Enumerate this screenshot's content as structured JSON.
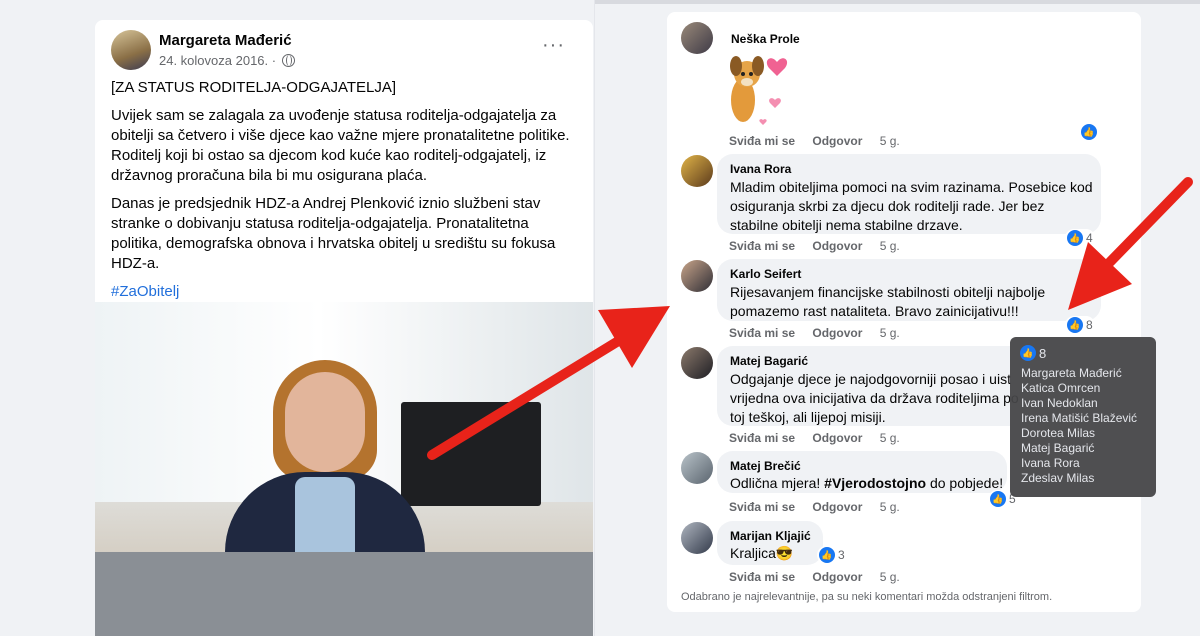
{
  "post": {
    "author": "Margareta Mađerić",
    "date": "24. kolovoza 2016.",
    "meta_sep": "·",
    "more": "···",
    "title": "[ZA STATUS RODITELJA-ODGAJATELJA]",
    "paragraph1": "Uvijek sam se zalagala za uvođenje statusa roditelja-odgajatelja za obitelji sa četvero i više djece kao važne mjere pronatalitetne politike. Roditelj koji bi ostao sa djecom kod kuće kao roditelj-odgajatelj, iz državnog proračuna bila bi mu osigurana plaća.",
    "paragraph2": "Danas je predsjednik HDZ-a Andrej Plenković iznio službeni stav stranke o dobivanju statusa roditelja-odgajatelja. Pronatalitetna politika, demografska obnova i hrvatska obitelj u središtu su fokusa HDZ-a.",
    "hashtag": "#ZaObitelj"
  },
  "actions": {
    "like": "Sviđa mi se",
    "reply": "Odgovor",
    "age": "5 g."
  },
  "comments": [
    {
      "name": "Neška Prole",
      "text": "",
      "likes": ""
    },
    {
      "name": "Ivana Rora",
      "text": "Mladim obiteljima pomoci na svim razinama. Posebice kod osiguranja skrbi za djecu dok roditelji rade. Jer bez stabilne obitelji nema stabilne drzave.",
      "likes": "4"
    },
    {
      "name": "Karlo Seifert",
      "text": "Rijesavanjem financijske stabilnosti obitelji najbolje pomazemo rast nataliteta. Bravo zainicijativu!!!",
      "likes": "8"
    },
    {
      "name": "Matej Bagarić",
      "text": "Odgajanje djece je najodgovorniji posao i uist vrijedna ova inicijativa da država roditeljima po toj teškoj, ali lijepoj misiji.",
      "likes": ""
    },
    {
      "name": "Matej Brečić",
      "text_pre": "Odlična mjera! ",
      "text_bold": "#Vjerodostojno",
      "text_post": " do pobjede!",
      "likes": "5"
    },
    {
      "name": "Marijan Kljajić",
      "text": "Kraljica😎",
      "likes": "3"
    }
  ],
  "footer_note": "Odabrano je najrelevantnije, pa su neki komentari možda odstranjeni filtrom.",
  "tooltip": {
    "count": "8",
    "names": [
      "Margareta Mađerić",
      "Katica Omrcen",
      "Ivan Nedoklan",
      "Irena Matišić Blažević",
      "Dorotea Milas",
      "Matej Bagarić",
      "Ivana Rora",
      "Zdeslav Milas"
    ]
  },
  "colors": {
    "accent": "#1877f2",
    "arrow": "#e8231a",
    "link": "#216fdb"
  }
}
